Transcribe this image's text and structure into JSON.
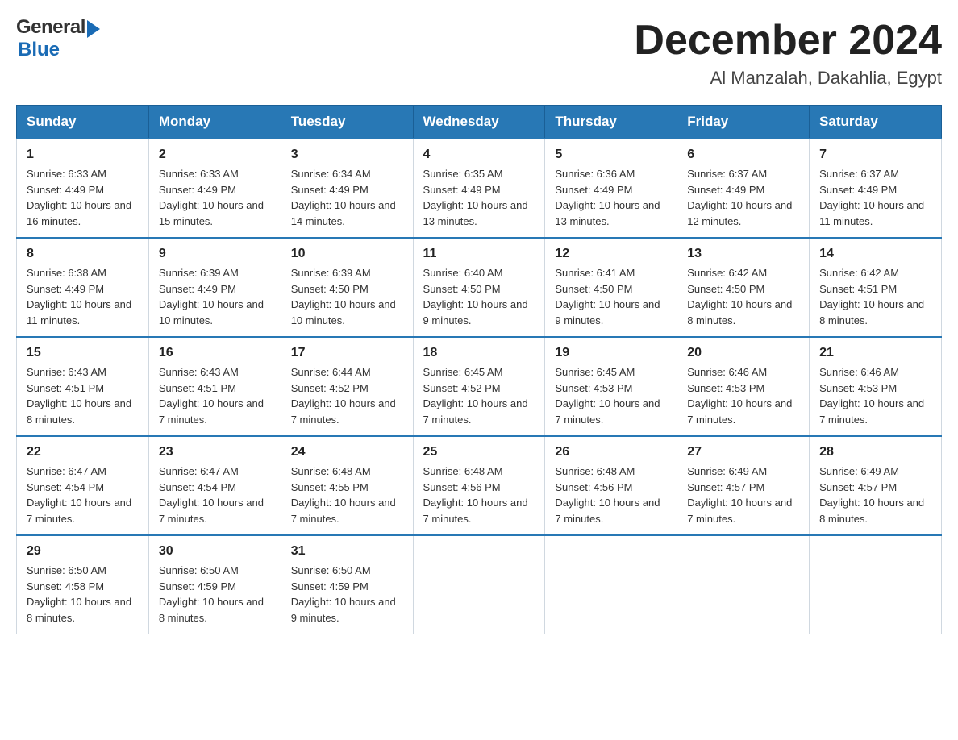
{
  "header": {
    "month_title": "December 2024",
    "location": "Al Manzalah, Dakahlia, Egypt",
    "logo_general": "General",
    "logo_blue": "Blue"
  },
  "calendar": {
    "days_of_week": [
      "Sunday",
      "Monday",
      "Tuesday",
      "Wednesday",
      "Thursday",
      "Friday",
      "Saturday"
    ],
    "weeks": [
      [
        {
          "day": "1",
          "sunrise": "6:33 AM",
          "sunset": "4:49 PM",
          "daylight": "10 hours and 16 minutes."
        },
        {
          "day": "2",
          "sunrise": "6:33 AM",
          "sunset": "4:49 PM",
          "daylight": "10 hours and 15 minutes."
        },
        {
          "day": "3",
          "sunrise": "6:34 AM",
          "sunset": "4:49 PM",
          "daylight": "10 hours and 14 minutes."
        },
        {
          "day": "4",
          "sunrise": "6:35 AM",
          "sunset": "4:49 PM",
          "daylight": "10 hours and 13 minutes."
        },
        {
          "day": "5",
          "sunrise": "6:36 AM",
          "sunset": "4:49 PM",
          "daylight": "10 hours and 13 minutes."
        },
        {
          "day": "6",
          "sunrise": "6:37 AM",
          "sunset": "4:49 PM",
          "daylight": "10 hours and 12 minutes."
        },
        {
          "day": "7",
          "sunrise": "6:37 AM",
          "sunset": "4:49 PM",
          "daylight": "10 hours and 11 minutes."
        }
      ],
      [
        {
          "day": "8",
          "sunrise": "6:38 AM",
          "sunset": "4:49 PM",
          "daylight": "10 hours and 11 minutes."
        },
        {
          "day": "9",
          "sunrise": "6:39 AM",
          "sunset": "4:49 PM",
          "daylight": "10 hours and 10 minutes."
        },
        {
          "day": "10",
          "sunrise": "6:39 AM",
          "sunset": "4:50 PM",
          "daylight": "10 hours and 10 minutes."
        },
        {
          "day": "11",
          "sunrise": "6:40 AM",
          "sunset": "4:50 PM",
          "daylight": "10 hours and 9 minutes."
        },
        {
          "day": "12",
          "sunrise": "6:41 AM",
          "sunset": "4:50 PM",
          "daylight": "10 hours and 9 minutes."
        },
        {
          "day": "13",
          "sunrise": "6:42 AM",
          "sunset": "4:50 PM",
          "daylight": "10 hours and 8 minutes."
        },
        {
          "day": "14",
          "sunrise": "6:42 AM",
          "sunset": "4:51 PM",
          "daylight": "10 hours and 8 minutes."
        }
      ],
      [
        {
          "day": "15",
          "sunrise": "6:43 AM",
          "sunset": "4:51 PM",
          "daylight": "10 hours and 8 minutes."
        },
        {
          "day": "16",
          "sunrise": "6:43 AM",
          "sunset": "4:51 PM",
          "daylight": "10 hours and 7 minutes."
        },
        {
          "day": "17",
          "sunrise": "6:44 AM",
          "sunset": "4:52 PM",
          "daylight": "10 hours and 7 minutes."
        },
        {
          "day": "18",
          "sunrise": "6:45 AM",
          "sunset": "4:52 PM",
          "daylight": "10 hours and 7 minutes."
        },
        {
          "day": "19",
          "sunrise": "6:45 AM",
          "sunset": "4:53 PM",
          "daylight": "10 hours and 7 minutes."
        },
        {
          "day": "20",
          "sunrise": "6:46 AM",
          "sunset": "4:53 PM",
          "daylight": "10 hours and 7 minutes."
        },
        {
          "day": "21",
          "sunrise": "6:46 AM",
          "sunset": "4:53 PM",
          "daylight": "10 hours and 7 minutes."
        }
      ],
      [
        {
          "day": "22",
          "sunrise": "6:47 AM",
          "sunset": "4:54 PM",
          "daylight": "10 hours and 7 minutes."
        },
        {
          "day": "23",
          "sunrise": "6:47 AM",
          "sunset": "4:54 PM",
          "daylight": "10 hours and 7 minutes."
        },
        {
          "day": "24",
          "sunrise": "6:48 AM",
          "sunset": "4:55 PM",
          "daylight": "10 hours and 7 minutes."
        },
        {
          "day": "25",
          "sunrise": "6:48 AM",
          "sunset": "4:56 PM",
          "daylight": "10 hours and 7 minutes."
        },
        {
          "day": "26",
          "sunrise": "6:48 AM",
          "sunset": "4:56 PM",
          "daylight": "10 hours and 7 minutes."
        },
        {
          "day": "27",
          "sunrise": "6:49 AM",
          "sunset": "4:57 PM",
          "daylight": "10 hours and 7 minutes."
        },
        {
          "day": "28",
          "sunrise": "6:49 AM",
          "sunset": "4:57 PM",
          "daylight": "10 hours and 8 minutes."
        }
      ],
      [
        {
          "day": "29",
          "sunrise": "6:50 AM",
          "sunset": "4:58 PM",
          "daylight": "10 hours and 8 minutes."
        },
        {
          "day": "30",
          "sunrise": "6:50 AM",
          "sunset": "4:59 PM",
          "daylight": "10 hours and 8 minutes."
        },
        {
          "day": "31",
          "sunrise": "6:50 AM",
          "sunset": "4:59 PM",
          "daylight": "10 hours and 9 minutes."
        },
        null,
        null,
        null,
        null
      ]
    ],
    "sunrise_label": "Sunrise:",
    "sunset_label": "Sunset:",
    "daylight_label": "Daylight:"
  }
}
